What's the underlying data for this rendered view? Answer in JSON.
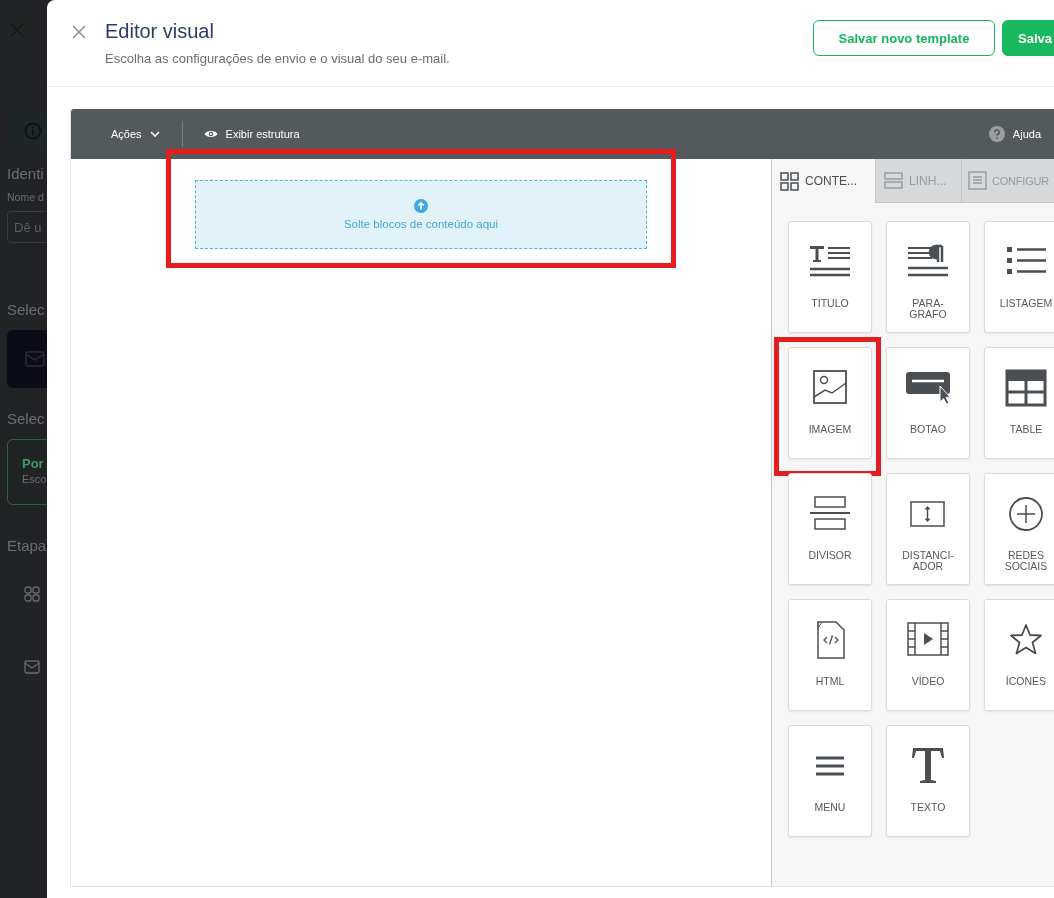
{
  "background_page": {
    "heading_1": "Identi",
    "field_label": "Nome d",
    "field_placeholder": "Dê u",
    "heading_2": "Selec",
    "heading_3": "Selec",
    "option": {
      "title": "Por",
      "subtitle": "Esco",
      "selected": true
    },
    "heading_4": "Etapa"
  },
  "modal": {
    "title": "Editor visual",
    "subtitle": "Escolha as configurações de envio e o visual do seu e-mail.",
    "buttons": [
      {
        "label": "Salvar novo template",
        "kind": "outline"
      },
      {
        "label": "Salva",
        "kind": "primary"
      }
    ]
  },
  "toolbar": {
    "actions": "Ações",
    "structure": "Exibir estrutura",
    "help": "Ajuda"
  },
  "dropzone": {
    "text": "Solte blocos de conteúdo aqui",
    "highlighted": true
  },
  "tabs": [
    {
      "label": "CONTE...",
      "kind": "content",
      "selected": true
    },
    {
      "label": "LINH...",
      "kind": "rows",
      "selected": false
    },
    {
      "label": "CONFIGUR",
      "kind": "settings",
      "selected": false
    }
  ],
  "blocks": [
    {
      "label": "TITULO",
      "kind": "title",
      "highlighted": false
    },
    {
      "label": "PARA-\nGRAFO",
      "kind": "paragraph",
      "highlighted": false
    },
    {
      "label": "LISTAGEM",
      "kind": "list",
      "highlighted": false
    },
    {
      "label": "IMAGEM",
      "kind": "image",
      "highlighted": true
    },
    {
      "label": "BOTAO",
      "kind": "button",
      "highlighted": false
    },
    {
      "label": "TABLE",
      "kind": "table",
      "highlighted": false
    },
    {
      "label": "DIVISOR",
      "kind": "divider",
      "highlighted": false
    },
    {
      "label": "DISTANCI-\nADOR",
      "kind": "spacer",
      "highlighted": false
    },
    {
      "label": "REDES\nSOCIAIS",
      "kind": "social",
      "highlighted": false
    },
    {
      "label": "HTML",
      "kind": "html",
      "highlighted": false
    },
    {
      "label": "VÍDEO",
      "kind": "video",
      "highlighted": false
    },
    {
      "label": "ÍCONES",
      "kind": "icons",
      "highlighted": false
    },
    {
      "label": "MENU",
      "kind": "menu",
      "highlighted": false
    },
    {
      "label": "TEXTO",
      "kind": "text",
      "highlighted": false
    }
  ]
}
